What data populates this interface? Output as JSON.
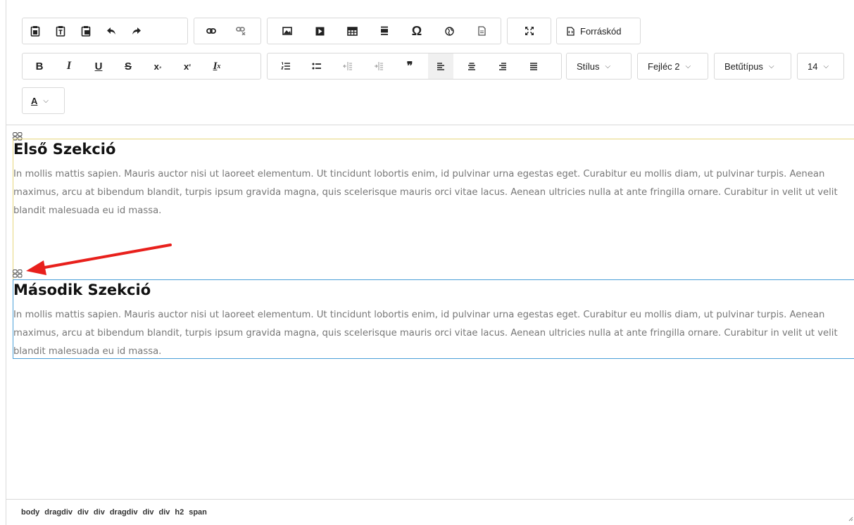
{
  "toolbar": {
    "row1": {
      "clipboard": [
        "paste-icon",
        "paste-text-icon",
        "paste-word-icon",
        "undo-icon",
        "redo-icon"
      ],
      "links": [
        "link-icon",
        "unlink-icon"
      ],
      "insert": [
        "image-icon",
        "video-icon",
        "table-icon",
        "horizontal-line-icon",
        "special-char-icon",
        "globe-icon",
        "page-icon"
      ],
      "special_char_glyph": "Ω",
      "maximize": "maximize-icon",
      "source_label": "Forráskód"
    },
    "row2": {
      "format": {
        "bold": "B",
        "italic": "I",
        "underline": "U",
        "strike": "S",
        "subscript": "x",
        "subscript_small": "₂",
        "superscript": "x",
        "superscript_small": "²",
        "clear": "I",
        "clear_small": "x"
      },
      "blocks": [
        "ordered-list-icon",
        "bullet-list-icon",
        "outdent-icon",
        "indent-icon",
        "blockquote-icon",
        "align-left-icon",
        "align-center-icon",
        "align-right-icon",
        "justify-icon"
      ],
      "blockquote_glyph": "❞",
      "style_label": "Stílus",
      "heading_label": "Fejléc 2",
      "font_label": "Betűtípus",
      "size_label": "14"
    },
    "row3": {
      "text_color_label": "A"
    }
  },
  "content": {
    "sections": [
      {
        "heading": "Első Szekció",
        "body": "In mollis mattis sapien. Mauris auctor nisi ut laoreet elementum. Ut tincidunt lobortis enim, id pulvinar urna egestas eget. Curabitur eu mollis diam, ut pulvinar turpis. Aenean maximus, arcu at bibendum blandit, turpis ipsum gravida magna, quis scelerisque mauris orci vitae lacus. Aenean ultricies nulla at ante fringilla ornare. Curabitur in velit ut velit blandit malesuada eu id massa."
      },
      {
        "heading": "Második Szekció",
        "body": "In mollis mattis sapien. Mauris auctor nisi ut laoreet elementum. Ut tincidunt lobortis enim, id pulvinar urna egestas eget. Curabitur eu mollis diam, ut pulvinar turpis. Aenean maximus, arcu at bibendum blandit, turpis ipsum gravida magna, quis scelerisque mauris orci vitae lacus. Aenean ultricies nulla at ante fringilla ornare. Curabitur in velit ut velit blandit malesuada eu id massa."
      }
    ]
  },
  "statusbar": {
    "path": [
      "body",
      "dragdiv",
      "div",
      "div",
      "dragdiv",
      "div",
      "div",
      "h2",
      "span"
    ]
  },
  "colors": {
    "section1_border": "#e6d57a",
    "section2_border": "#4a9fd8",
    "annotation_arrow": "#e8201c"
  }
}
